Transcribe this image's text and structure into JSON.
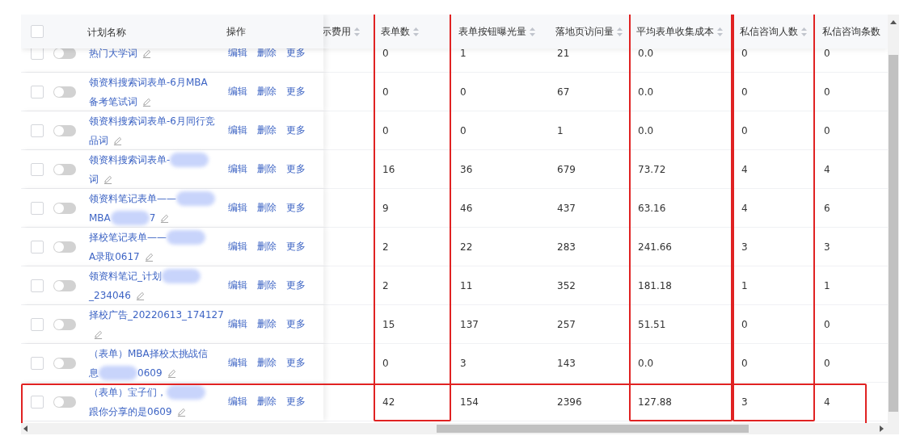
{
  "fixed_columns": {
    "select_all": {
      "checked": false
    },
    "name": "计划名称",
    "actions": "操作"
  },
  "cut_column": {
    "label": "示费用",
    "sortable": true
  },
  "columns": [
    {
      "label": "表单数",
      "sortable": true,
      "highlighted": true
    },
    {
      "label": "表单按钮曝光量",
      "sortable": true,
      "highlighted": false
    },
    {
      "label": "落地页访问量",
      "sortable": true,
      "highlighted": false
    },
    {
      "label": "平均表单收集成本",
      "sortable": true,
      "highlighted": true
    },
    {
      "label": "私信咨询人数",
      "sortable": true,
      "highlighted": true
    },
    {
      "label": "私信咨询条数",
      "sortable": false,
      "highlighted": false
    }
  ],
  "rows": [
    {
      "checked": false,
      "on": false,
      "highlighted": false,
      "name_lines": [
        {
          "text": "热门大学词"
        }
      ],
      "actions": [
        "编辑",
        "删除",
        "更多"
      ],
      "values": [
        "0",
        "1",
        "21",
        "0.0",
        "0",
        "0"
      ]
    },
    {
      "checked": false,
      "on": false,
      "highlighted": false,
      "name_lines": [
        {
          "text": "领资料搜索词表单-6月MBA"
        },
        {
          "text": "备考笔试词"
        }
      ],
      "actions": [
        "编辑",
        "删除",
        "更多"
      ],
      "values": [
        "0",
        "0",
        "67",
        "0.0",
        "0",
        "0"
      ]
    },
    {
      "checked": false,
      "on": false,
      "highlighted": false,
      "name_lines": [
        {
          "text": "领资料搜索词表单-6月同行竞"
        },
        {
          "text": "品词"
        }
      ],
      "actions": [
        "编辑",
        "删除",
        "更多"
      ],
      "values": [
        "0",
        "0",
        "1",
        "0.0",
        "0",
        "0"
      ]
    },
    {
      "checked": false,
      "on": false,
      "highlighted": false,
      "name_lines": [
        {
          "text": "领资料搜索词表单-",
          "blur": true
        },
        {
          "text": "词"
        }
      ],
      "actions": [
        "编辑",
        "删除",
        "更多"
      ],
      "values": [
        "16",
        "36",
        "679",
        "73.72",
        "4",
        "4"
      ]
    },
    {
      "checked": false,
      "on": false,
      "highlighted": false,
      "name_lines": [
        {
          "text": "领资料笔记表单——",
          "blur": true
        },
        {
          "text": "MBA",
          "blur": true,
          "tail": "7"
        }
      ],
      "actions": [
        "编辑",
        "删除",
        "更多"
      ],
      "values": [
        "9",
        "46",
        "437",
        "63.16",
        "4",
        "6"
      ]
    },
    {
      "checked": false,
      "on": false,
      "highlighted": false,
      "name_lines": [
        {
          "text": "择校笔记表单——",
          "blur": true
        },
        {
          "text": "A录取0617"
        }
      ],
      "actions": [
        "编辑",
        "删除",
        "更多"
      ],
      "values": [
        "2",
        "22",
        "283",
        "241.66",
        "3",
        "3"
      ]
    },
    {
      "checked": false,
      "on": false,
      "highlighted": false,
      "name_lines": [
        {
          "text": "领资料笔记_计划",
          "blur": true
        },
        {
          "text": "_234046"
        }
      ],
      "actions": [
        "编辑",
        "删除",
        "更多"
      ],
      "values": [
        "2",
        "11",
        "352",
        "181.18",
        "1",
        "1"
      ]
    },
    {
      "checked": false,
      "on": false,
      "highlighted": false,
      "name_lines": [
        {
          "text": "择校广告_20220613_174127"
        }
      ],
      "actions": [
        "编辑",
        "删除",
        "更多"
      ],
      "values": [
        "15",
        "137",
        "257",
        "51.51",
        "0",
        "0"
      ]
    },
    {
      "checked": false,
      "on": false,
      "highlighted": false,
      "name_lines": [
        {
          "text": "（表单）MBA择校太挑战信"
        },
        {
          "text": "息",
          "blur": true,
          "tail": "0609"
        }
      ],
      "actions": [
        "编辑",
        "删除",
        "更多"
      ],
      "values": [
        "0",
        "3",
        "143",
        "0.0",
        "0",
        "0"
      ]
    },
    {
      "checked": false,
      "on": false,
      "highlighted": true,
      "name_lines": [
        {
          "text": "（表单）宝子们，",
          "blur": true
        },
        {
          "text": "跟你分享的是0609"
        }
      ],
      "actions": [
        "编辑",
        "删除",
        "更多"
      ],
      "values": [
        "42",
        "154",
        "2396",
        "127.88",
        "3",
        "4"
      ]
    }
  ]
}
